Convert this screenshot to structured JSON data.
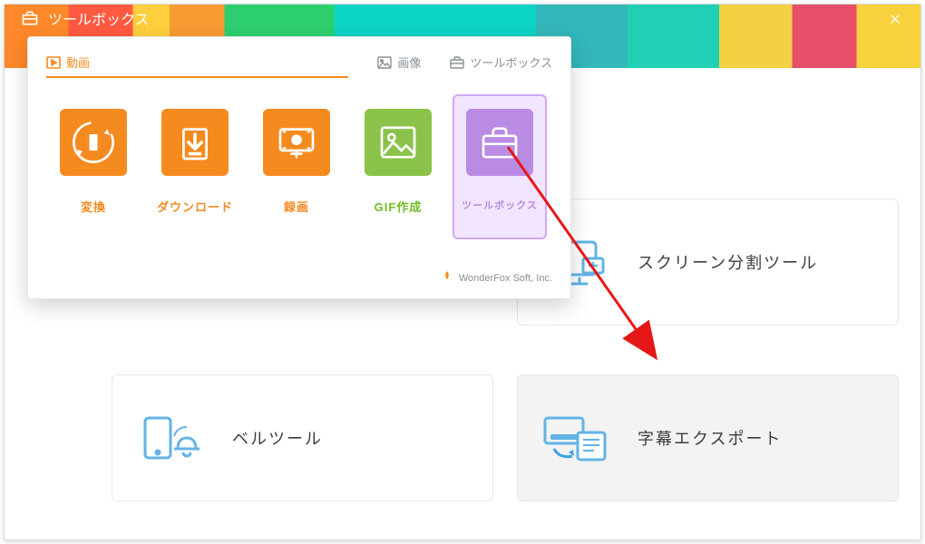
{
  "window": {
    "title": "ツールボックス",
    "close": "×"
  },
  "tools": {
    "top_left": "スクリーン分割ツール",
    "bottom_left": "ベルツール",
    "bottom_right": "字幕エクスポート"
  },
  "popup": {
    "tabs": {
      "video": "動画",
      "image": "画像",
      "toolbox": "ツールボックス"
    },
    "tiles": {
      "convert": "変換",
      "download": "ダウンロード",
      "record": "録画",
      "gif": "GIF作成",
      "toolbox": "ツールボックス"
    },
    "footer": "WonderFox Soft, Inc."
  }
}
